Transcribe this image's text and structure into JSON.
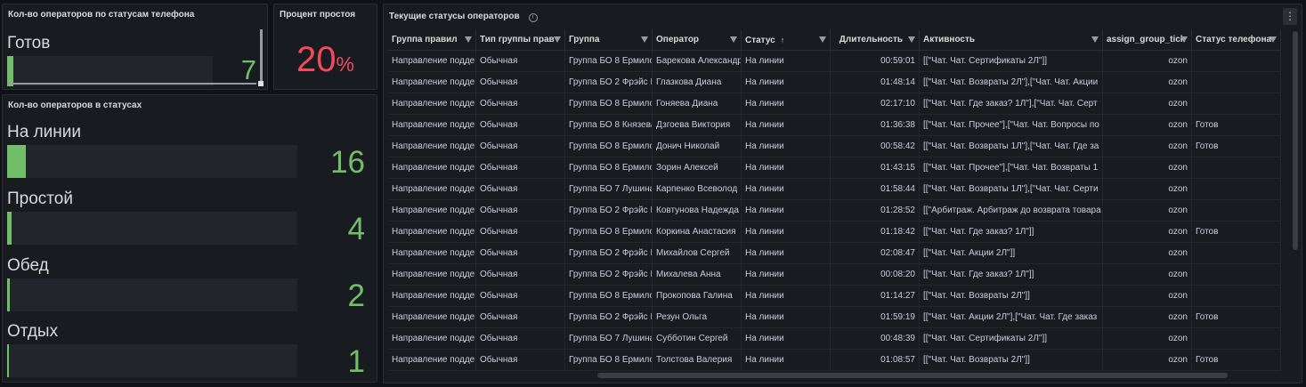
{
  "phone_panel": {
    "title": "Кол-во операторов по статусам телефона",
    "items": [
      {
        "label": "Готов",
        "value": "7",
        "fill": 0.03
      }
    ]
  },
  "idle_panel": {
    "title": "Процент простоя",
    "value": "20",
    "unit": "%"
  },
  "status_panel": {
    "title": "Кол-во операторов в статусах",
    "items": [
      {
        "label": "На линии",
        "value": "16",
        "fill": 0.065
      },
      {
        "label": "Простой",
        "value": "4",
        "fill": 0.016
      },
      {
        "label": "Обед",
        "value": "2",
        "fill": 0.008
      },
      {
        "label": "Отдых",
        "value": "1",
        "fill": 0.004
      }
    ]
  },
  "table_panel": {
    "title": "Текущие статусы операторов",
    "info_icon": "info-icon",
    "menu_glyph": "⋮",
    "columns": [
      "Группа правил",
      "Тип группы прав",
      "Группа",
      "Оператор",
      "Статус",
      "Длительность",
      "Активность",
      "assign_group_tick",
      "Статус телефона"
    ],
    "sort_indicator": "↑",
    "rows": [
      [
        "Направление подде",
        "Обычная",
        "Группа БО 8 Ермило",
        "Барекова Александр",
        "На линии",
        "00:59:01",
        "[[\"Чат. Чат. Сертификаты 2Л\"]]",
        "ozon",
        ""
      ],
      [
        "Направление подде",
        "Обычная",
        "Группа БО 2 Фрэйс К",
        "Глазкова Диана",
        "На линии",
        "01:48:14",
        "[[\"Чат. Чат. Возвраты 2Л\"],[\"Чат. Чат. Акции",
        "ozon",
        ""
      ],
      [
        "Направление подде",
        "Обычная",
        "Группа БО 8 Ермило",
        "Гоняева Диана",
        "На линии",
        "02:17:10",
        "[[\"Чат. Чат. Где заказ? 1Л\"],[\"Чат. Чат. Серт",
        "ozon",
        ""
      ],
      [
        "Направление подде",
        "Обычная",
        "Группа БО 8 Князева",
        "Дзгоева Виктория",
        "На линии",
        "01:36:38",
        "[[\"Чат. Чат. Прочее\"],[\"Чат. Чат. Вопросы по",
        "ozon",
        "Готов"
      ],
      [
        "Направление подде",
        "Обычная",
        "Группа БО 8 Ермило",
        "Донич Николай",
        "На линии",
        "00:58:42",
        "[[\"Чат. Чат. Возвраты 1Л\"],[\"Чат. Чат. Где за",
        "ozon",
        "Готов"
      ],
      [
        "Направление подде",
        "Обычная",
        "Группа БО 8 Ермило",
        "Зорин Алексей",
        "На линии",
        "01:43:15",
        "[[\"Чат. Чат. Прочее\"],[\"Чат. Чат. Возвраты 1",
        "ozon",
        ""
      ],
      [
        "Направление подде",
        "Обычная",
        "Группа БО 7 Лушина",
        "Карпенко Всеволод",
        "На линии",
        "01:58:44",
        "[[\"Чат. Чат. Возвраты 1Л\"],[\"Чат. Чат. Серти",
        "ozon",
        ""
      ],
      [
        "Направление подде",
        "Обычная",
        "Группа БО 2 Фрэйс К",
        "Ковтунова Надежда",
        "На линии",
        "01:28:52",
        "[[\"Арбитраж. Арбитраж до возврата товара",
        "ozon",
        ""
      ],
      [
        "Направление подде",
        "Обычная",
        "Группа БО 8 Ермило",
        "Коркина Анастасия",
        "На линии",
        "01:18:42",
        "[[\"Чат. Чат. Где заказ? 1Л\"]]",
        "ozon",
        "Готов"
      ],
      [
        "Направление подде",
        "Обычная",
        "Группа БО 2 Фрэйс К",
        "Михайлов Сергей",
        "На линии",
        "02:08:47",
        "[[\"Чат. Чат. Акции 2Л\"]]",
        "ozon",
        ""
      ],
      [
        "Направление подде",
        "Обычная",
        "Группа БО 2 Фрэйс К",
        "Михалева Анна",
        "На линии",
        "00:08:20",
        "[[\"Чат. Чат. Где заказ? 1Л\"]]",
        "ozon",
        ""
      ],
      [
        "Направление подде",
        "Обычная",
        "Группа БО 8 Ермило",
        "Прокопова Галина",
        "На линии",
        "01:14:27",
        "[[\"Чат. Чат. Возвраты 2Л\"]]",
        "ozon",
        ""
      ],
      [
        "Направление подде",
        "Обычная",
        "Группа БО 2 Фрэйс К",
        "Резун Ольга",
        "На линии",
        "01:59:19",
        "[[\"Чат. Чат. Акции 2Л\"],[\"Чат. Чат. Где заказ",
        "ozon",
        "Готов"
      ],
      [
        "Направление подде",
        "Обычная",
        "Группа БО 7 Лушина",
        "Субботин Сергей",
        "На линии",
        "00:48:39",
        "[[\"Чат. Чат. Сертификаты 2Л\"]]",
        "ozon",
        ""
      ],
      [
        "Направление подде",
        "Обычная",
        "Группа БО 8 Ермило",
        "Толстова Валерия",
        "На линии",
        "01:08:57",
        "[[\"Чат. Чат. Возвраты 2Л\"]]",
        "ozon",
        "Готов"
      ]
    ]
  },
  "colors": {
    "background": "#111217",
    "panel": "#181b1f",
    "bar_green": "#73bf69",
    "idle_red": "#f2495c"
  }
}
